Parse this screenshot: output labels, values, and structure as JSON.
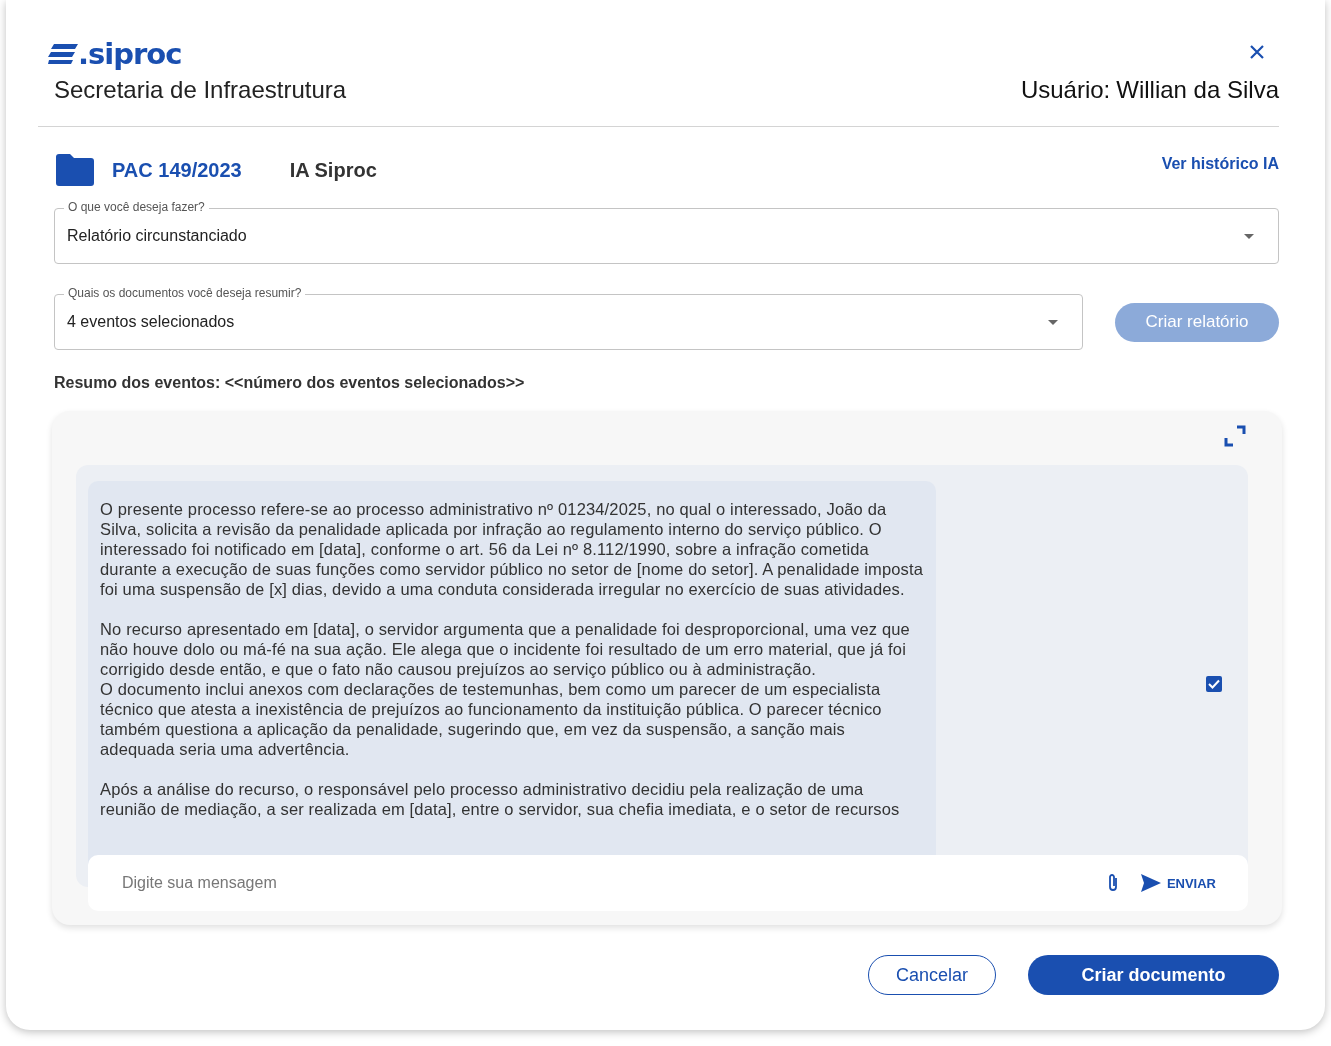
{
  "header": {
    "logo": ".siproc",
    "department": "Secretaria de Infraestrutura",
    "user_label": "Usuário:",
    "user_name": "Willian da Silva"
  },
  "process": {
    "code": "PAC 149/2023",
    "title": "IA Siproc",
    "history_link": "Ver histórico IA"
  },
  "action_select": {
    "label": "O que você deseja fazer?",
    "value": "Relatório circunstanciado"
  },
  "documents_select": {
    "label": "Quais os documentos você deseja resumir?",
    "value": "4 eventos selecionados"
  },
  "create_report_button": {
    "label": "Criar relatório",
    "disabled": true
  },
  "summary_heading": "Resumo dos eventos: <<número dos eventos selecionados>>",
  "chat": {
    "message": [
      [
        "O presente processo refere-se ao processo administrativo nº 01234/2025, no qual o interessado, João da Silva, solicita a revisão da penalidade aplicada por infração ao regulamento interno do serviço público. O interessado foi notificado em [data], conforme o art. 56 da Lei nº 8.112/1990, sobre a infração cometida durante a execução de suas funções como servidor público no setor de [nome do setor]. A penalidade imposta foi uma suspensão de [x] dias, devido a uma conduta considerada irregular no exercício de suas atividades."
      ],
      [
        "No recurso apresentado em [data], o servidor argumenta que a penalidade foi desproporcional, uma vez que não houve dolo ou má-fé na sua ação. Ele alega que o incidente foi resultado de um erro material, que já foi corrigido desde então, e que o fato não causou prejuízos ao serviço público ou à administração.",
        "O documento inclui anexos com declarações de testemunhas, bem como um parecer de um especialista técnico que atesta a inexistência de prejuízos ao funcionamento da instituição pública. O parecer técnico também questiona a aplicação da penalidade, sugerindo que, em vez da suspensão, a sanção mais adequada seria uma advertência."
      ],
      [
        "Após a análise do recurso, o responsável pelo processo administrativo decidiu pela realização de uma reunião de mediação, a ser realizada em [data], entre o servidor, sua chefia imediata, e o setor de recursos"
      ]
    ],
    "message_checked": true,
    "input_placeholder": "Digite sua mensagem",
    "send_label": "ENVIAR"
  },
  "buttons": [
    {
      "label": "Cancelar",
      "kind": "secondary"
    },
    {
      "label": "Criar documento",
      "kind": "primary"
    }
  ]
}
